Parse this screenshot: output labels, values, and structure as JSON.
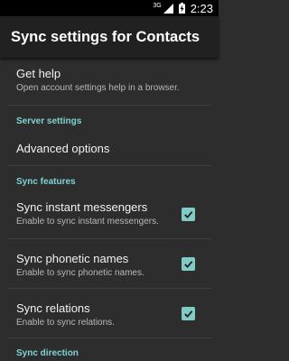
{
  "status_bar": {
    "network": "3G",
    "time": "2:23"
  },
  "app_bar": {
    "title": "Sync settings for Contacts"
  },
  "items": {
    "get_help": {
      "title": "Get help",
      "summary": "Open account settings help in a browser."
    },
    "server_settings_header": "Server settings",
    "advanced_options": {
      "title": "Advanced options"
    },
    "sync_features_header": "Sync features",
    "sync_im": {
      "title": "Sync instant messengers",
      "summary": "Enable to sync instant messengers.",
      "checked": true
    },
    "sync_phonetic": {
      "title": "Sync phonetic names",
      "summary": "Enable to sync phonetic names.",
      "checked": true
    },
    "sync_relations": {
      "title": "Sync relations",
      "summary": "Enable to sync relations.",
      "checked": true
    },
    "sync_direction_header": "Sync direction"
  },
  "colors": {
    "accent": "#80cbc4",
    "category": "#7fd3d3",
    "background": "#2d2d2d",
    "app_bar": "#212121"
  }
}
